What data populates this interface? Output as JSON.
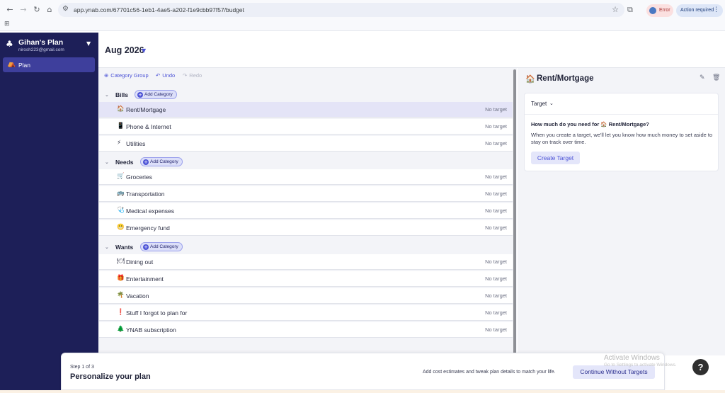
{
  "browser": {
    "url": "app.ynab.com/67701c56-1eb1-4ae5-a202-f1e9cbb97f57/budget",
    "error_label": "Error",
    "action_label": "Action required"
  },
  "sidebar": {
    "plan_name": "Gihan's Plan",
    "email": "nirosh223@gmail.com",
    "items": [
      {
        "label": "Plan"
      }
    ]
  },
  "header": {
    "month": "Aug 2026"
  },
  "toolbar": {
    "category_group_label": "Category Group",
    "undo_label": "Undo",
    "redo_label": "Redo"
  },
  "add_category_label": "Add Category",
  "groups": [
    {
      "name": "Bills",
      "categories": [
        {
          "emoji": "🏠",
          "name": "Rent/Mortgage",
          "target": "No target"
        },
        {
          "emoji": "📱",
          "name": "Phone & Internet",
          "target": "No target"
        },
        {
          "emoji": "⚡",
          "name": "Utilities",
          "target": "No target"
        }
      ]
    },
    {
      "name": "Needs",
      "categories": [
        {
          "emoji": "🛒",
          "name": "Groceries",
          "target": "No target"
        },
        {
          "emoji": "🚌",
          "name": "Transportation",
          "target": "No target"
        },
        {
          "emoji": "🩺",
          "name": "Medical expenses",
          "target": "No target"
        },
        {
          "emoji": "😬",
          "name": "Emergency fund",
          "target": "No target"
        }
      ]
    },
    {
      "name": "Wants",
      "categories": [
        {
          "emoji": "🍽",
          "name": "Dining out",
          "target": "No target"
        },
        {
          "emoji": "🎁",
          "name": "Entertainment",
          "target": "No target"
        },
        {
          "emoji": "🌴",
          "name": "Vacation",
          "target": "No target"
        },
        {
          "emoji": "❗",
          "name": "Stuff I forgot to plan for",
          "target": "No target"
        },
        {
          "emoji": "🌲",
          "name": "YNAB subscription",
          "target": "No target"
        }
      ]
    }
  ],
  "inspector": {
    "emoji": "🏠",
    "title": "Rent/Mortgage",
    "target_header": "Target",
    "question": "How much do you need for 🏠 Rent/Mortgage?",
    "description": "When you create a target, we'll let you know how much money to set aside to stay on track over time.",
    "create_button": "Create Target"
  },
  "onboarding": {
    "step": "Step 1 of 3",
    "title": "Personalize your plan",
    "hint": "Add cost estimates and tweak plan details to match your life.",
    "continue_button": "Continue Without Targets"
  },
  "watermark": {
    "line1": "Activate Windows",
    "line2": "Go to Settings to activate Windows."
  },
  "colors": {
    "sidebar_bg": "#1d1f58",
    "accent": "#4b52d6",
    "selected_row": "#e4e4f7"
  }
}
